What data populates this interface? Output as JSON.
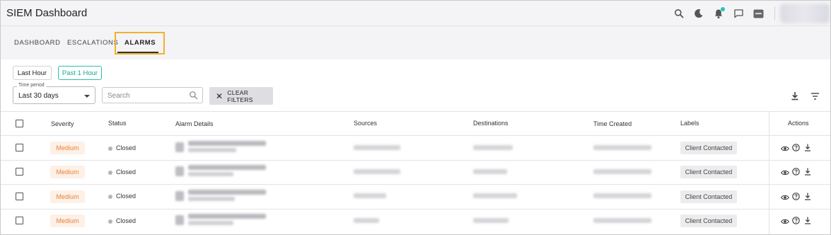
{
  "app": {
    "title": "SIEM Dashboard"
  },
  "topbar_icons": [
    "search-icon",
    "moon-icon",
    "bell-icon",
    "chat-icon",
    "sos-icon"
  ],
  "tabs": [
    {
      "label": "DASHBOARD",
      "active": false
    },
    {
      "label": "ESCALATIONS",
      "active": false
    },
    {
      "label": "ALARMS",
      "active": true
    }
  ],
  "quick_filters": {
    "last_hour": "Last Hour",
    "past_1_hour": "Past 1 Hour"
  },
  "time_period": {
    "legend": "Time period",
    "value": "Last 30 days"
  },
  "search": {
    "placeholder": "Search"
  },
  "clear_filters": {
    "label": "CLEAR FILTERS"
  },
  "table": {
    "columns": {
      "severity": "Severity",
      "status": "Status",
      "alarm_details": "Alarm Details",
      "sources": "Sources",
      "destinations": "Destinations",
      "time_created": "Time Created",
      "labels": "Labels",
      "actions": "Actions"
    },
    "rows": [
      {
        "severity": "Medium",
        "status": "Closed",
        "label": "Client Contacted"
      },
      {
        "severity": "Medium",
        "status": "Closed",
        "label": "Client Contacted"
      },
      {
        "severity": "Medium",
        "status": "Closed",
        "label": "Client Contacted"
      },
      {
        "severity": "Medium",
        "status": "Closed",
        "label": "Client Contacted"
      }
    ]
  },
  "colors": {
    "accent_teal": "#2dbfa6",
    "severity_medium": "#e8833a",
    "highlight": "#f2b02c",
    "notification_dot": "#1fc7c0"
  }
}
